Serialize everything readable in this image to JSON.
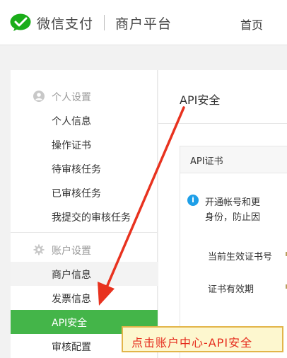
{
  "header": {
    "brand": "微信支付",
    "platform": "商户平台",
    "nav_home": "首页"
  },
  "sidebar": {
    "groups": [
      {
        "title": "个人设置",
        "icon": "user-circle-icon",
        "items": [
          "个人信息",
          "操作证书",
          "待审核任务",
          "已审核任务",
          "我提交的审核任务"
        ]
      },
      {
        "title": "账户设置",
        "icon": "gear-icon",
        "items": [
          "商户信息",
          "发票信息",
          "API安全",
          "审核配置"
        ]
      }
    ],
    "active_item": "API安全",
    "hovered_item": "商户信息"
  },
  "main": {
    "page_title": "API安全",
    "card_title": "API证书",
    "notice_line1": "开通帐号和更",
    "notice_line2": "身份，防止因",
    "field_cert_no": "当前生效证书号",
    "field_validity": "证书有效期"
  },
  "annotation": {
    "callout_text": "点击账户中心-API安全"
  },
  "colors": {
    "brand_green": "#44b549",
    "arrow_red": "#e8321f",
    "callout_bg": "#fdf7cf",
    "callout_border": "#e2b54a",
    "callout_text": "#e52b1c",
    "info_blue": "#1e9fe8"
  }
}
